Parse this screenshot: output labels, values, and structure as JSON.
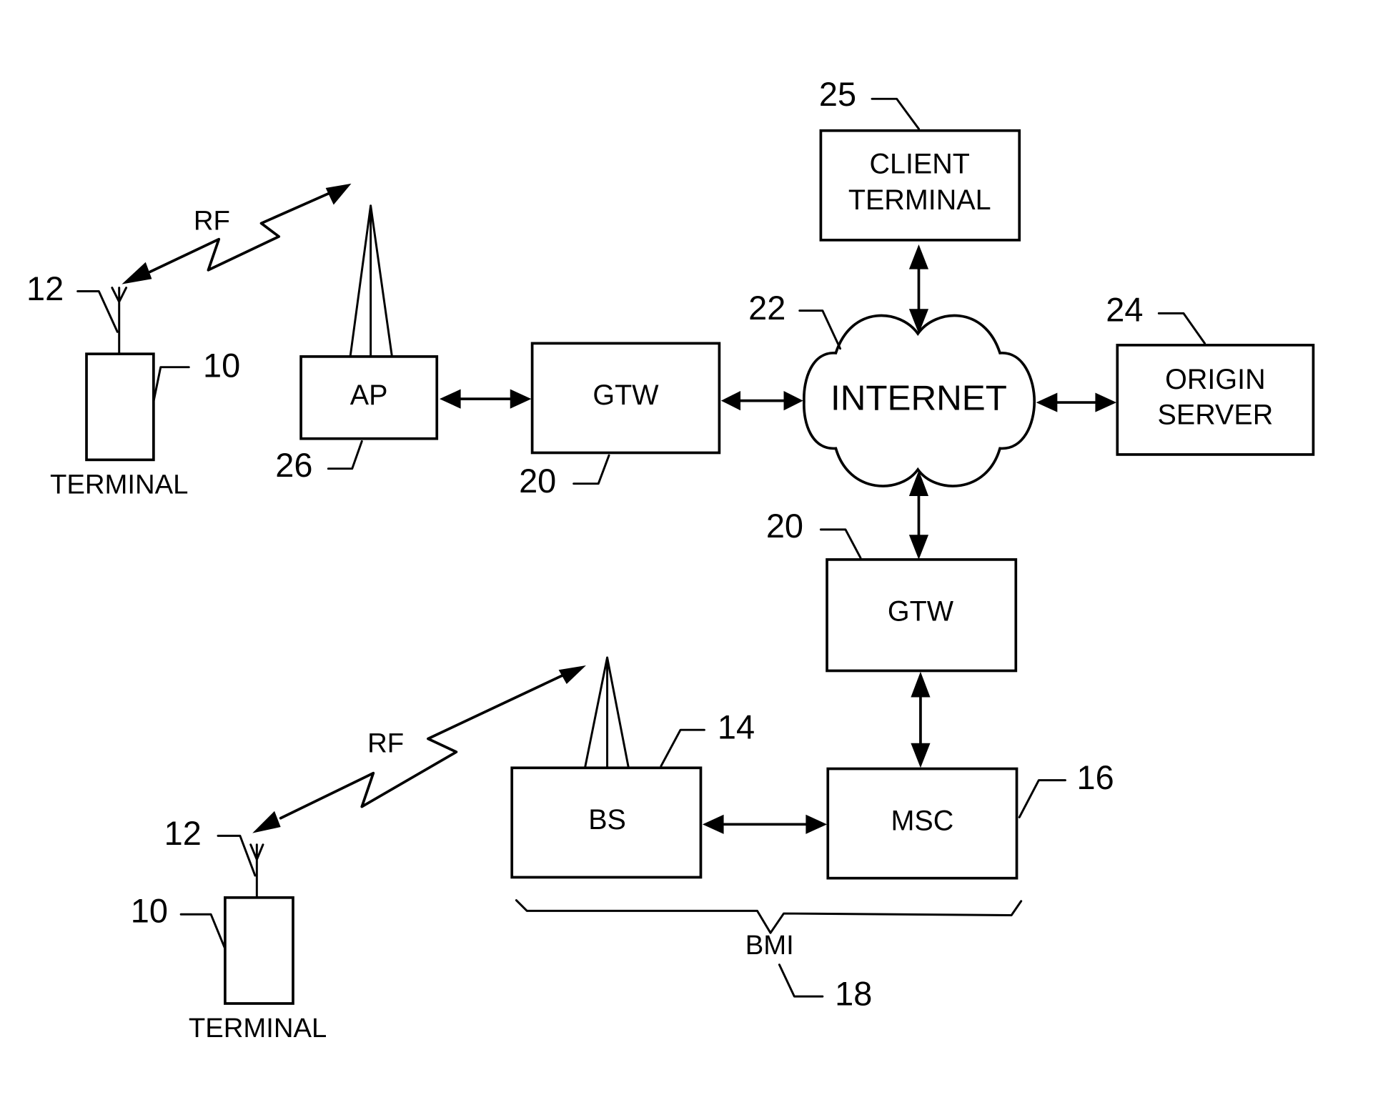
{
  "diagram": {
    "nodes": {
      "terminal_top": {
        "label": "TERMINAL",
        "ref": "10",
        "antenna_ref": "12"
      },
      "terminal_bottom": {
        "label": "TERMINAL",
        "ref": "10",
        "antenna_ref": "12"
      },
      "ap": {
        "label": "AP",
        "ref": "26"
      },
      "gtw_top": {
        "label": "GTW",
        "ref": "20"
      },
      "internet": {
        "label": "INTERNET",
        "ref": "22"
      },
      "client_terminal": {
        "label_line1": "CLIENT",
        "label_line2": "TERMINAL",
        "ref": "25"
      },
      "origin_server": {
        "label_line1": "ORIGIN",
        "label_line2": "SERVER",
        "ref": "24"
      },
      "gtw_bottom": {
        "label": "GTW",
        "ref": "20"
      },
      "bs": {
        "label": "BS",
        "ref": "14"
      },
      "msc": {
        "label": "MSC",
        "ref": "16"
      },
      "bmi": {
        "label": "BMI",
        "ref": "18"
      }
    },
    "links": {
      "rf_top": {
        "label": "RF",
        "type": "wireless",
        "from": "terminal_top",
        "to": "ap"
      },
      "rf_bottom": {
        "label": "RF",
        "type": "wireless",
        "from": "terminal_bottom",
        "to": "bs"
      },
      "ap_gtw": {
        "from": "ap",
        "to": "gtw_top",
        "type": "bidirectional"
      },
      "gtw_internet": {
        "from": "gtw_top",
        "to": "internet",
        "type": "bidirectional"
      },
      "client_internet": {
        "from": "client_terminal",
        "to": "internet",
        "type": "bidirectional"
      },
      "internet_origin": {
        "from": "internet",
        "to": "origin_server",
        "type": "bidirectional"
      },
      "internet_gtw2": {
        "from": "internet",
        "to": "gtw_bottom",
        "type": "bidirectional"
      },
      "gtw2_msc": {
        "from": "gtw_bottom",
        "to": "msc",
        "type": "bidirectional"
      },
      "bs_msc": {
        "from": "bs",
        "to": "msc",
        "type": "bidirectional"
      }
    }
  }
}
